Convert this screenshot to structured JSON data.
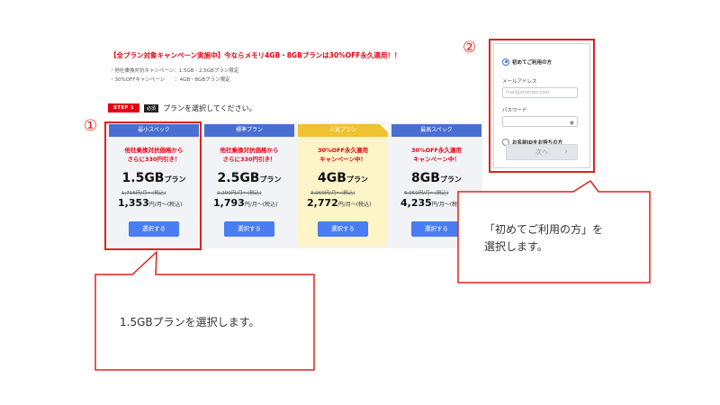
{
  "campaign": {
    "title": "【全プラン対象キャンペーン実施中】今ならメモリ4GB・8GBプランは30%OFF永久適用！！",
    "notes": [
      "・他社乗換対抗キャンペーン：1.5GB・2.5GBプラン限定",
      "・30%OFFキャンペーン　　：4GB・8GBプラン限定"
    ]
  },
  "step": {
    "badge": "STEP 1",
    "required": "必須",
    "text": "プランを選択してください。"
  },
  "plans": [
    {
      "header": "最小スペック",
      "promo_line1": "他社乗換対抗価格から",
      "promo_line2": "さらに330円引き！",
      "name": "1.5GB",
      "name_unit": "プラン",
      "old_price": "1,716円/月～(税込)",
      "price": "1,353",
      "price_unit": "円/月～(税込)",
      "button": "選択する"
    },
    {
      "header": "標準プラン",
      "promo_line1": "他社乗換対抗価格から",
      "promo_line2": "さらに330円引き！",
      "name": "2.5GB",
      "name_unit": "プラン",
      "old_price": "2,200円/月～(税込)",
      "price": "1,793",
      "price_unit": "円/月～(税込)",
      "button": "選択する"
    },
    {
      "header": "人気プラン",
      "promo_line1": "30%OFF永久適用",
      "promo_line2": "キャンペーン中！",
      "name": "4GB",
      "name_unit": "プラン",
      "old_price": "3,960円/月～(税込)",
      "price": "2,772",
      "price_unit": "円/月～(税込)",
      "button": "選択する"
    },
    {
      "header": "最高スペック",
      "promo_line1": "30%OFF永久適用",
      "promo_line2": "キャンペーン中！",
      "name": "8GB",
      "name_unit": "プラン",
      "old_price": "6,050円/月～(税込)",
      "price": "4,235",
      "price_unit": "円/月～(税込)",
      "button": "選択する"
    }
  ],
  "login": {
    "first_time_label": "初めてご利用の方",
    "email_label": "メールアドレス",
    "email_placeholder": "mail@onamae.com",
    "password_label": "パスワード",
    "existing_id_label": "お名前IDをお持ちの方",
    "next_label": "次へ",
    "next_chevron": "›",
    "eye_icon_glyph": "◉"
  },
  "annotations": {
    "marker_1": "①",
    "marker_2": "②",
    "callout_1": "1.5GBプランを選択します。",
    "callout_2_line1": "「初めてご利用の方」を",
    "callout_2_line2": "選択します。"
  },
  "colors": {
    "accent_red": "#e0221c",
    "plan_blue": "#4a6fd2",
    "popular_gold": "#f0c232",
    "button_blue": "#4a7df0"
  }
}
